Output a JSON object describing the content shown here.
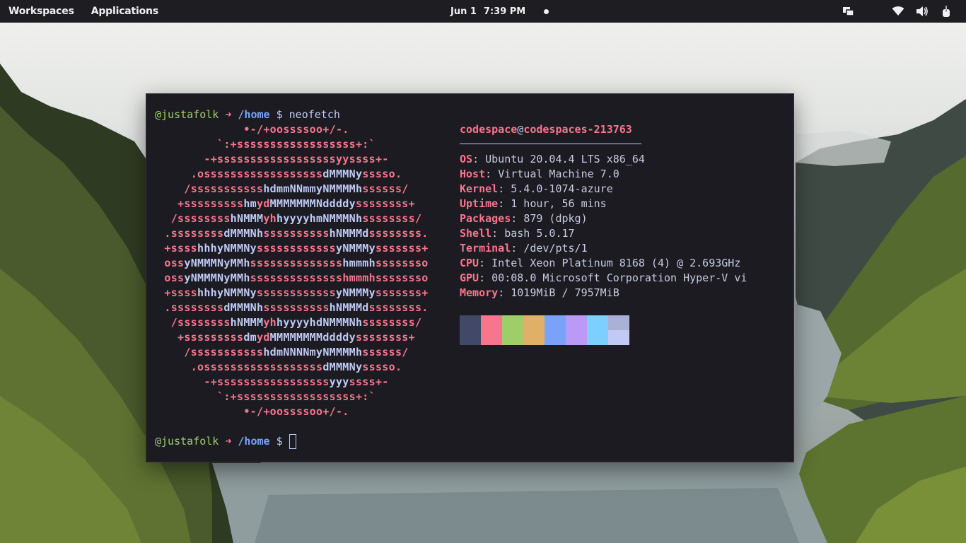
{
  "panel": {
    "workspaces": "Workspaces",
    "applications": "Applications",
    "date": "Jun 1",
    "time": "7:39 PM",
    "icons": [
      "screens-icon",
      "wifi-icon",
      "volume-icon",
      "power-icon"
    ]
  },
  "terminal": {
    "prompt1": {
      "user": "@justafolk",
      "arrow": "➜",
      "dir": "/home",
      "dollar": "$",
      "command": "neofetch"
    },
    "logo_lines": [
      [
        [
          "c1",
          "•-/+oossssoo+/-."
        ]
      ],
      [
        [
          "c1",
          "`:+ssssssssssssssssss+:`"
        ]
      ],
      [
        [
          "c1",
          "-+ssssssssssssssssssyyssss+-"
        ]
      ],
      [
        [
          "c1",
          ".ossssssssssssssssss"
        ],
        [
          "c2",
          "dMMMNy"
        ],
        [
          "c1",
          "sssso."
        ]
      ],
      [
        [
          "c1",
          "/sssssssssss"
        ],
        [
          "c2",
          "hdmmNNmmyNMMMMh"
        ],
        [
          "c1",
          "ssssss/"
        ]
      ],
      [
        [
          "c1",
          "+sssssssss"
        ],
        [
          "c2",
          "hm"
        ],
        [
          "c1",
          "yd"
        ],
        [
          "c2",
          "MMMMMMMNddddy"
        ],
        [
          "c1",
          "ssssssss+"
        ]
      ],
      [
        [
          "c1",
          "/ssssssss"
        ],
        [
          "c2",
          "hNMMM"
        ],
        [
          "c1",
          "yh"
        ],
        [
          "c2",
          "hyyyyhmNMMMNh"
        ],
        [
          "c1",
          "ssssssss/"
        ]
      ],
      [
        [
          "c1",
          ".ssssssss"
        ],
        [
          "c2",
          "dMMMNh"
        ],
        [
          "c1",
          "ssssssssss"
        ],
        [
          "c2",
          "hNMMMd"
        ],
        [
          "c1",
          "ssssssss."
        ]
      ],
      [
        [
          "c1",
          "+ssss"
        ],
        [
          "c2",
          "hhhyNMMNy"
        ],
        [
          "c1",
          "ssssssssssss"
        ],
        [
          "c2",
          "yNMMMy"
        ],
        [
          "c1",
          "sssssss+"
        ]
      ],
      [
        [
          "c1",
          "oss"
        ],
        [
          "c2",
          "yNMMMNyMMh"
        ],
        [
          "c1",
          "ssssssssssssss"
        ],
        [
          "c2",
          "hmmmh"
        ],
        [
          "c1",
          "ssssssso"
        ]
      ],
      [
        [
          "c1",
          "oss"
        ],
        [
          "c2",
          "yNMMMNyMMh"
        ],
        [
          "c1",
          "sssssssssssssshmmmhssssssso"
        ]
      ],
      [
        [
          "c1",
          "+ssss"
        ],
        [
          "c2",
          "hhhyNMMNy"
        ],
        [
          "c1",
          "ssssssssssss"
        ],
        [
          "c2",
          "yNMMMy"
        ],
        [
          "c1",
          "sssssss+"
        ]
      ],
      [
        [
          "c1",
          ".ssssssss"
        ],
        [
          "c2",
          "dMMMNh"
        ],
        [
          "c1",
          "ssssssssss"
        ],
        [
          "c2",
          "hNMMMd"
        ],
        [
          "c1",
          "ssssssss."
        ]
      ],
      [
        [
          "c1",
          "/ssssssss"
        ],
        [
          "c2",
          "hNMMM"
        ],
        [
          "c1",
          "yh"
        ],
        [
          "c2",
          "hyyyyhdNMMMNh"
        ],
        [
          "c1",
          "ssssssss/"
        ]
      ],
      [
        [
          "c1",
          "+sssssssss"
        ],
        [
          "c2",
          "dm"
        ],
        [
          "c1",
          "yd"
        ],
        [
          "c2",
          "MMMMMMMMddddy"
        ],
        [
          "c1",
          "ssssssss+"
        ]
      ],
      [
        [
          "c1",
          "/sssssssssss"
        ],
        [
          "c2",
          "hdmNNNNmyNMMMMh"
        ],
        [
          "c1",
          "ssssss/"
        ]
      ],
      [
        [
          "c1",
          ".ossssssssssssssssss"
        ],
        [
          "c2",
          "dMMMNy"
        ],
        [
          "c1",
          "sssso."
        ]
      ],
      [
        [
          "c1",
          "-+sssssssssssssssss"
        ],
        [
          "c2",
          "yyy"
        ],
        [
          "c1",
          "ssss+-"
        ]
      ],
      [
        [
          "c1",
          "`:+ssssssssssssssssss+:`"
        ]
      ],
      [
        [
          "c1",
          "•-/+oossssoo+/-."
        ]
      ]
    ],
    "info_title": {
      "user": "codespace",
      "at": "@",
      "host": "codespaces-213763"
    },
    "info": [
      {
        "key": "OS",
        "value": "Ubuntu 20.04.4 LTS x86_64"
      },
      {
        "key": "Host",
        "value": "Virtual Machine 7.0"
      },
      {
        "key": "Kernel",
        "value": "5.4.0-1074-azure"
      },
      {
        "key": "Uptime",
        "value": "1 hour, 56 mins"
      },
      {
        "key": "Packages",
        "value": "879 (dpkg)"
      },
      {
        "key": "Shell",
        "value": "bash 5.0.17"
      },
      {
        "key": "Terminal",
        "value": "/dev/pts/1"
      },
      {
        "key": "CPU",
        "value": "Intel Xeon Platinum 8168 (4) @ 2.693GHz"
      },
      {
        "key": "GPU",
        "value": "00:08.0 Microsoft Corporation Hyper-V vi"
      },
      {
        "key": "Memory",
        "value": "1019MiB / 7957MiB"
      }
    ],
    "palette": [
      {
        "top": "#414868",
        "bottom": "#414868"
      },
      {
        "top": "#f7768e",
        "bottom": "#f7768e"
      },
      {
        "top": "#9ece6a",
        "bottom": "#9ece6a"
      },
      {
        "top": "#e0af68",
        "bottom": "#e0af68"
      },
      {
        "top": "#7aa2f7",
        "bottom": "#7aa2f7"
      },
      {
        "top": "#bb9af7",
        "bottom": "#bb9af7"
      },
      {
        "top": "#7dcfff",
        "bottom": "#7dcfff"
      },
      {
        "top": "#a9b1d6",
        "bottom": "#c0caf5"
      }
    ],
    "prompt2": {
      "user": "@justafolk",
      "arrow": "➜",
      "dir": "/home",
      "dollar": "$"
    }
  }
}
